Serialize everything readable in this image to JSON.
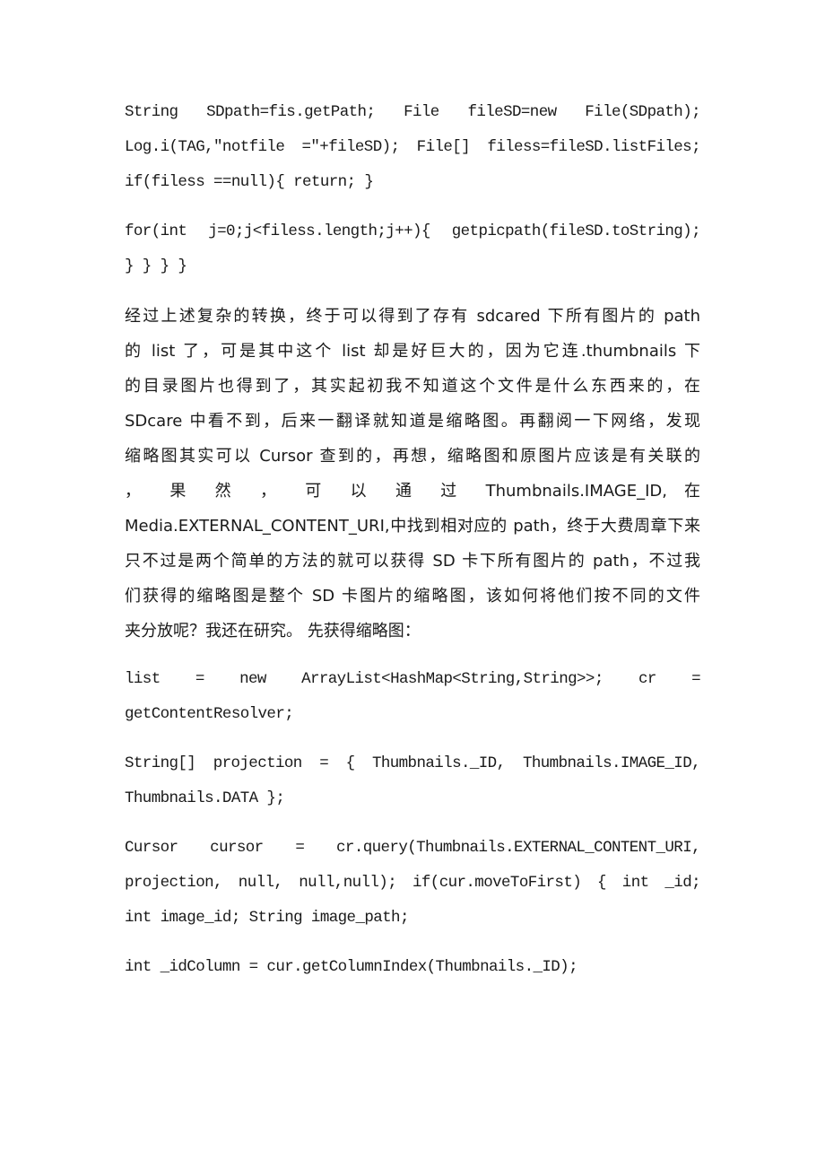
{
  "document": {
    "paragraphs": [
      {
        "id": "code-sdpath",
        "lines": [
          "String SDpath=fis.getPath; File fileSD=new File(SDpath);",
          "Log.i(TAG,\"notfile =\"+fileSD); File[] filess=fileSD.listFiles;",
          "if(filess ==null){ return; }"
        ]
      },
      {
        "id": "code-for-loop",
        "lines": [
          "for(int j=0;j<filess.length;j++){ getpicpath(fileSD.toString);",
          "} } } }"
        ]
      },
      {
        "id": "explanation",
        "lines": [
          "经过上述复杂的转换，终于可以得到了存有 sdcared 下所有图片的 path",
          "的 list 了，可是其中这个 list 却是好巨大的，因为它连.thumbnails 下",
          "的目录图片也得到了，其实起初我不知道这个文件是什么东西来的，在",
          "SDcare 中看不到，后来一翻译就知道是缩略图。再翻阅一下网络，发现",
          "缩略图其实可以 Cursor 查到的，再想，缩略图和原图片应该是有关联的",
          "， 果 然 ， 可 以 通 过 Thumbnails.IMAGE_ID, 在",
          "Media.EXTERNAL_CONTENT_URI,中找到相对应的 path，终于大费周章下来",
          "只不过是两个简单的方法的就可以获得 SD 卡下所有图片的 path，不过我",
          "们获得的缩略图是整个 SD 卡图片的缩略图，该如何将他们按不同的文件",
          "夹分放呢？我还在研究。 先获得缩略图："
        ]
      },
      {
        "id": "code-list",
        "lines": [
          "list = new ArrayList<HashMap<String,String>>; cr =",
          "getContentResolver;"
        ]
      },
      {
        "id": "code-projection",
        "lines": [
          "String[] projection = { Thumbnails._ID, Thumbnails.IMAGE_ID,",
          "Thumbnails.DATA };"
        ]
      },
      {
        "id": "code-cursor",
        "lines": [
          "Cursor cursor = cr.query(Thumbnails.EXTERNAL_CONTENT_URI,",
          "projection, null, null,null); if(cur.moveToFirst) { int _id;",
          "int image_id; String image_path;"
        ]
      },
      {
        "id": "code-idcolumn",
        "lines": [
          "int _idColumn = cur.getColumnIndex(Thumbnails._ID);"
        ]
      }
    ]
  }
}
